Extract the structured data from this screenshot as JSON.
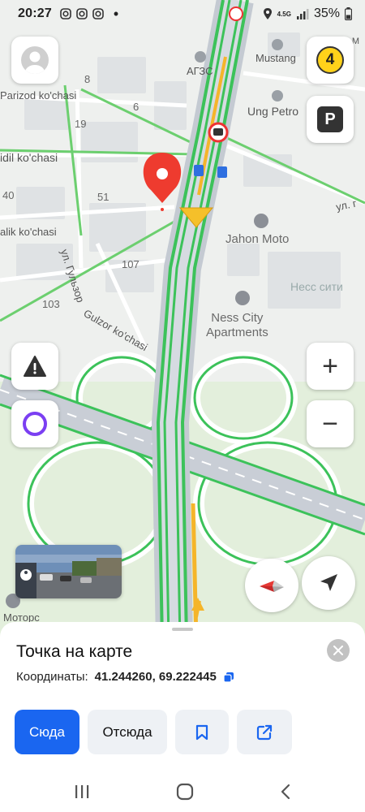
{
  "status_bar": {
    "time": "20:27",
    "network": "4.5G",
    "battery": "35%"
  },
  "map": {
    "labels": {
      "street_parizod": "Parizod ko'chasi",
      "street_idil": "idil ko'chasi",
      "street_alik": "alik ko'chasi",
      "street_gulzor_cyr": "ул. Гульзор",
      "street_gulzor_lat": "Gulzor ko'chasi",
      "street_ul_right": "ул. г",
      "num_8": "8",
      "num_6": "6",
      "num_19": "19",
      "num_40": "40",
      "num_51": "51",
      "num_107": "107",
      "num_103": "103",
      "poi_mustang": "Mustang",
      "poi_agzs": "АГЗС",
      "poi_ung_petro": "Ung Petro",
      "poi_jahon_moto": "Jahon Moto",
      "poi_ness_city_apartments": "Ness City\nApartments",
      "poi_ness_city_cyr": "Несс сити",
      "poi_motors": "Моторс",
      "poi_top_right": "ор-М"
    }
  },
  "controls": {
    "traffic_level": "4",
    "parking_label": "P",
    "zoom_in": "+",
    "zoom_out": "−"
  },
  "sheet": {
    "title": "Точка на карте",
    "coords_label": "Координаты:",
    "coords_value": "41.244260, 69.222445",
    "actions": {
      "here": "Сюда",
      "from": "Отсюда"
    }
  },
  "colors": {
    "accent": "#1a66f0",
    "traffic_green": "#3cc25a",
    "traffic_yellow": "#f5b52a",
    "pin_red": "#ee3b2f",
    "alice_purple": "#7b3ff2"
  },
  "icons": [
    "instagram-icon",
    "location-icon",
    "signal-icon",
    "battery-icon",
    "alert-icon",
    "alice-icon",
    "compass-icon",
    "locate-icon",
    "close-icon",
    "copy-icon",
    "bookmark-icon",
    "share-icon",
    "recents-icon",
    "home-icon",
    "back-icon"
  ]
}
